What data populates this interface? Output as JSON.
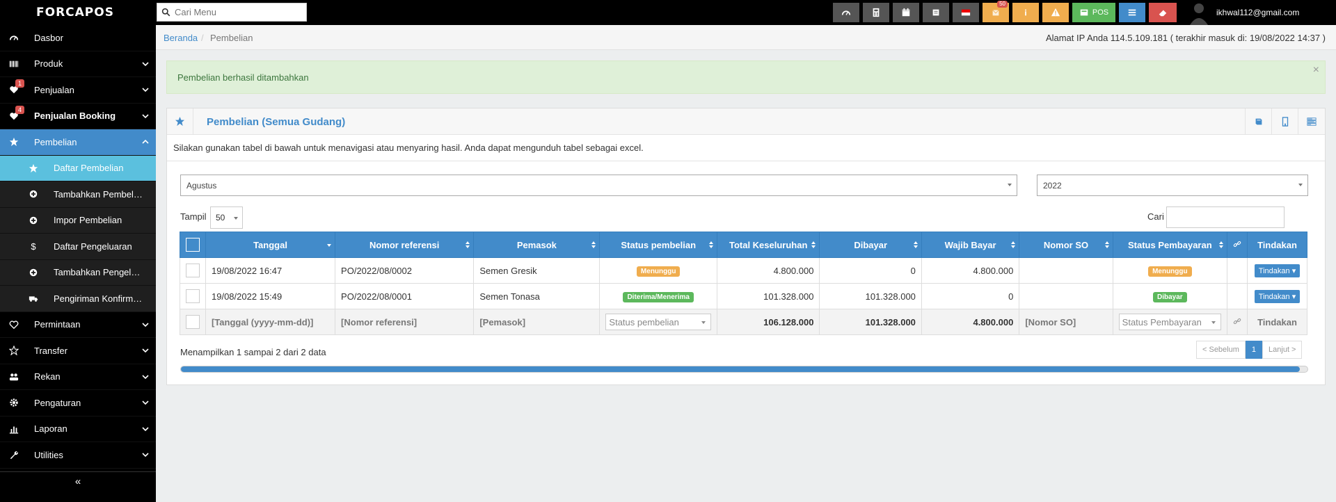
{
  "app": {
    "logo": "FORCAPOS"
  },
  "topbar": {
    "search_placeholder": "Cari Menu",
    "notification_count": "50",
    "pos_label": "POS",
    "user_email": "ikhwal112@gmail.com"
  },
  "sidebar": {
    "items": [
      {
        "label": "Dasbor"
      },
      {
        "label": "Produk"
      },
      {
        "label": "Penjualan",
        "badge": "1"
      },
      {
        "label": "Penjualan Booking",
        "badge": "4"
      },
      {
        "label": "Pembelian"
      },
      {
        "label": "Daftar Pembelian"
      },
      {
        "label": "Tambahkan Pembelian"
      },
      {
        "label": "Impor Pembelian"
      },
      {
        "label": "Daftar Pengeluaran"
      },
      {
        "label": "Tambahkan Pengeluaran"
      },
      {
        "label": "Pengiriman Konfirmasi"
      },
      {
        "label": "Permintaan"
      },
      {
        "label": "Transfer"
      },
      {
        "label": "Rekan"
      },
      {
        "label": "Pengaturan"
      },
      {
        "label": "Laporan"
      },
      {
        "label": "Utilities"
      }
    ],
    "collapse_glyph": "«"
  },
  "breadcrumb": {
    "home": "Beranda",
    "current": "Pembelian"
  },
  "ip_info": "Alamat IP Anda 114.5.109.181 ( terakhir masuk di: 19/08/2022 14:37 )",
  "alert": {
    "message": "Pembelian berhasil ditambahkan",
    "close": "×"
  },
  "box": {
    "title": "Pembelian (Semua Gudang)",
    "intro": "Silakan gunakan tabel di bawah untuk menavigasi atau menyaring hasil. Anda dapat mengunduh tabel sebagai excel.",
    "month": "Agustus",
    "year": "2022",
    "show_label": "Tampil",
    "show_value": "50",
    "search_label": "Cari"
  },
  "table": {
    "headers": [
      "Tanggal",
      "Nomor referensi",
      "Pemasok",
      "Status pembelian",
      "Total Keseluruhan",
      "Dibayar",
      "Wajib Bayar",
      "Nomor SO",
      "Status Pembayaran",
      "Tindakan"
    ],
    "rows": [
      {
        "date": "19/08/2022 16:47",
        "ref": "PO/2022/08/0002",
        "supplier": "Semen Gresik",
        "status": "Menunggu",
        "total": "4.800.000",
        "paid": "0",
        "due": "4.800.000",
        "so": "",
        "pay_status": "Menunggu",
        "action": "Tindakan ▾"
      },
      {
        "date": "19/08/2022 15:49",
        "ref": "PO/2022/08/0001",
        "supplier": "Semen Tonasa",
        "status": "Diterima/Menerima",
        "total": "101.328.000",
        "paid": "101.328.000",
        "due": "0",
        "so": "",
        "pay_status": "Dibayar",
        "action": "Tindakan ▾"
      }
    ],
    "footer": {
      "date": "[Tanggal (yyyy-mm-dd)]",
      "ref": "[Nomor referensi]",
      "supplier": "[Pemasok]",
      "status": "Status pembelian",
      "total": "106.128.000",
      "paid": "101.328.000",
      "due": "4.800.000",
      "so": "[Nomor SO]",
      "pay_status": "Status Pembayaran",
      "action": "Tindakan"
    }
  },
  "pagination": {
    "info": "Menampilkan 1 sampai 2 dari 2 data",
    "prev": "< Sebelum",
    "page": "1",
    "next": "Lanjut >"
  },
  "scroll_progress": 0.993,
  "colors": {
    "primary": "#428bca",
    "success": "#5cb85c",
    "warning": "#f0ad4e",
    "info": "#5bc0de",
    "danger": "#d9534f"
  }
}
